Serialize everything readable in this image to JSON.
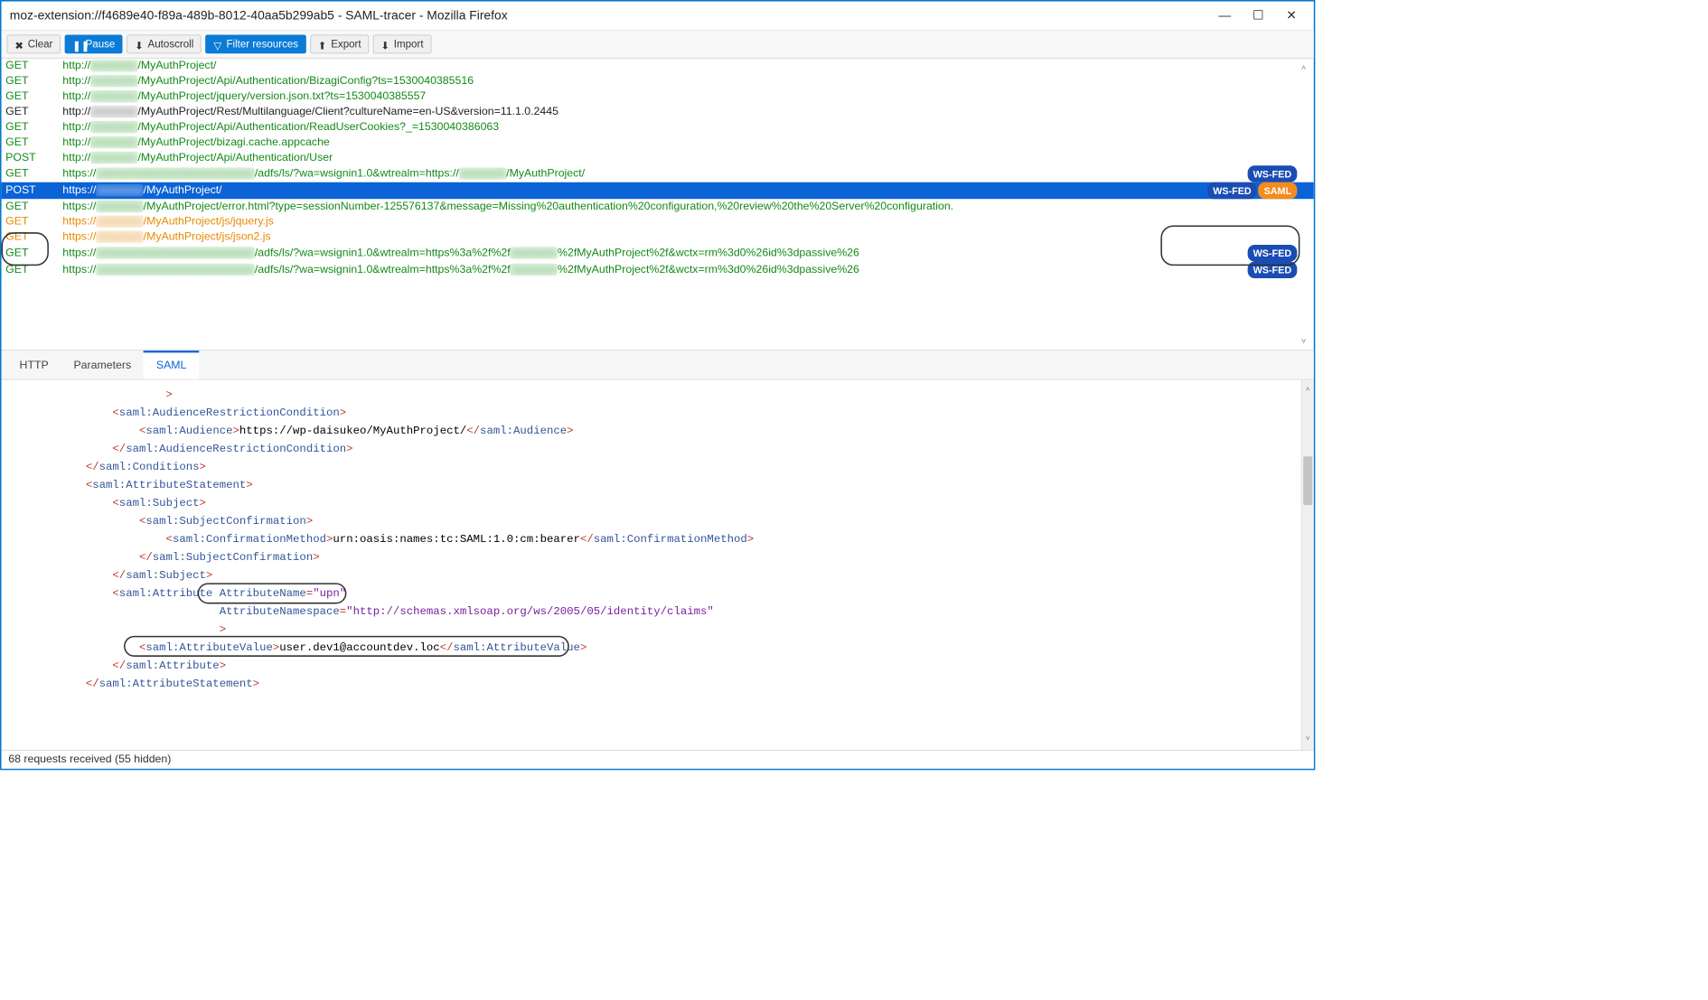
{
  "window": {
    "title": "moz-extension://f4689e40-f89a-489b-8012-40aa5b299ab5 - SAML-tracer - Mozilla Firefox"
  },
  "toolbar": {
    "clear": "Clear",
    "pause": "Pause",
    "autoscroll": "Autoscroll",
    "filter": "Filter resources",
    "export": "Export",
    "import": "Import"
  },
  "requests": [
    {
      "method": "GET",
      "cls": "row-green",
      "pre": "http://",
      "blur": "xxxxxxxx",
      "post": "/MyAuthProject/",
      "badges": [],
      "blurcls": "blur"
    },
    {
      "method": "GET",
      "cls": "row-green",
      "pre": "http://",
      "blur": "xxxxxxxx",
      "post": "/MyAuthProject/Api/Authentication/BizagiConfig?ts=1530040385516",
      "badges": [],
      "blurcls": "blur"
    },
    {
      "method": "GET",
      "cls": "row-green",
      "pre": "http://",
      "blur": "xxxxxxxx",
      "post": "/MyAuthProject/jquery/version.json.txt?ts=1530040385557",
      "badges": [],
      "blurcls": "blur"
    },
    {
      "method": "GET",
      "cls": "row-black",
      "pre": "http://",
      "blur": "xxxxxxxx",
      "post": "/MyAuthProject/Rest/Multilanguage/Client?cultureName=en-US&version=11.1.0.2445",
      "badges": [],
      "blurcls": "blur blk"
    },
    {
      "method": "GET",
      "cls": "row-green",
      "pre": "http://",
      "blur": "xxxxxxxx",
      "post": "/MyAuthProject/Api/Authentication/ReadUserCookies?_=1530040386063",
      "badges": [],
      "blurcls": "blur"
    },
    {
      "method": "GET",
      "cls": "row-green",
      "pre": "http://",
      "blur": "xxxxxxxx",
      "post": "/MyAuthProject/bizagi.cache.appcache",
      "badges": [],
      "blurcls": "blur"
    },
    {
      "method": "POST",
      "cls": "row-green",
      "pre": "http://",
      "blur": "xxxxxxxx",
      "post": "/MyAuthProject/Api/Authentication/User",
      "badges": [],
      "blurcls": "blur"
    },
    {
      "method": "GET",
      "cls": "row-green",
      "pre": "https://",
      "blur": "xxxxxxxxxxxxxxxxxxxxxxxxxxxx",
      "post": "/adfs/ls/?wa=wsignin1.0&wtrealm=https://",
      "blur2": "xxxxxxxx",
      "post2": "/MyAuthProject/",
      "badges": [
        "WS-FED"
      ],
      "blurcls": "blur"
    },
    {
      "method": "POST",
      "cls": "row-blue-sel",
      "pre": "https://",
      "blur": "xxxxxxxx",
      "post": "/MyAuthProject/",
      "badges": [
        "WS-FED",
        "SAML"
      ],
      "blurcls": "blur sel",
      "selected": true
    },
    {
      "method": "GET",
      "cls": "row-green",
      "pre": "https://",
      "blur": "xxxxxxxx",
      "post": "/MyAuthProject/error.html?type=sessionNumber-125576137&message=Missing%20authentication%20configuration,%20review%20the%20Server%20configuration.",
      "badges": [],
      "blurcls": "blur"
    },
    {
      "method": "GET",
      "cls": "row-orange",
      "pre": "https://",
      "blur": "xxxxxxxx",
      "post": "/MyAuthProject/js/jquery.js",
      "badges": [],
      "blurcls": "blur orng"
    },
    {
      "method": "GET",
      "cls": "row-orange",
      "pre": "https://",
      "blur": "xxxxxxxx",
      "post": "/MyAuthProject/js/json2.js",
      "badges": [],
      "blurcls": "blur orng"
    },
    {
      "method": "GET",
      "cls": "row-green",
      "pre": "https://",
      "blur": "xxxxxxxxxxxxxxxxxxxxxxxxxxxx",
      "post": "/adfs/ls/?wa=wsignin1.0&wtrealm=https%3a%2f%2f",
      "blur2": "xxxxxxxx",
      "post2": "%2fMyAuthProject%2f&wctx=rm%3d0%26id%3dpassive%26",
      "badges": [
        "WS-FED"
      ],
      "blurcls": "blur"
    },
    {
      "method": "GET",
      "cls": "row-green",
      "pre": "https://",
      "blur": "xxxxxxxxxxxxxxxxxxxxxxxxxxxx",
      "post": "/adfs/ls/?wa=wsignin1.0&wtrealm=https%3a%2f%2f",
      "blur2": "xxxxxxxx",
      "post2": "%2fMyAuthProject%2f&wctx=rm%3d0%26id%3dpassive%26",
      "badges": [
        "WS-FED"
      ],
      "blurcls": "blur"
    }
  ],
  "tabs": {
    "http": "HTTP",
    "parameters": "Parameters",
    "saml": "SAML",
    "active": "saml"
  },
  "saml_detail": {
    "lines": [
      {
        "indent": 4,
        "t": "close-angle",
        "text": ">"
      },
      {
        "indent": 2,
        "t": "tag-open",
        "name": "saml:AudienceRestrictionCondition"
      },
      {
        "indent": 3,
        "t": "inline",
        "open": "saml:Audience",
        "text": "https://wp-daisukeo/MyAuthProject/",
        "close": "saml:Audience"
      },
      {
        "indent": 2,
        "t": "tag-close",
        "name": "saml:AudienceRestrictionCondition"
      },
      {
        "indent": 1,
        "t": "tag-close",
        "name": "saml:Conditions"
      },
      {
        "indent": 1,
        "t": "tag-open",
        "name": "saml:AttributeStatement"
      },
      {
        "indent": 2,
        "t": "tag-open",
        "name": "saml:Subject"
      },
      {
        "indent": 3,
        "t": "tag-open",
        "name": "saml:SubjectConfirmation"
      },
      {
        "indent": 4,
        "t": "inline",
        "open": "saml:ConfirmationMethod",
        "text": "urn:oasis:names:tc:SAML:1.0:cm:bearer",
        "close": "saml:ConfirmationMethod"
      },
      {
        "indent": 3,
        "t": "tag-close",
        "name": "saml:SubjectConfirmation"
      },
      {
        "indent": 2,
        "t": "tag-close",
        "name": "saml:Subject"
      },
      {
        "indent": 2,
        "t": "attr-open",
        "name": "saml:Attribute",
        "attr": "AttributeName",
        "val": "\"upn\""
      },
      {
        "indent": 6,
        "t": "attr-line",
        "attr": "AttributeNamespace",
        "val": "\"http://schemas.xmlsoap.org/ws/2005/05/identity/claims\""
      },
      {
        "indent": 6,
        "t": "close-angle",
        "text": ">"
      },
      {
        "indent": 3,
        "t": "inline",
        "open": "saml:AttributeValue",
        "text": "user.dev1@accountdev.loc",
        "close": "saml:AttributeValue"
      },
      {
        "indent": 2,
        "t": "tag-close",
        "name": "saml:Attribute"
      },
      {
        "indent": 1,
        "t": "tag-close",
        "name": "saml:AttributeStatement"
      }
    ]
  },
  "statusbar": {
    "text": "68 requests received (55 hidden)"
  },
  "badges": {
    "wsfed": "WS-FED",
    "saml": "SAML"
  }
}
